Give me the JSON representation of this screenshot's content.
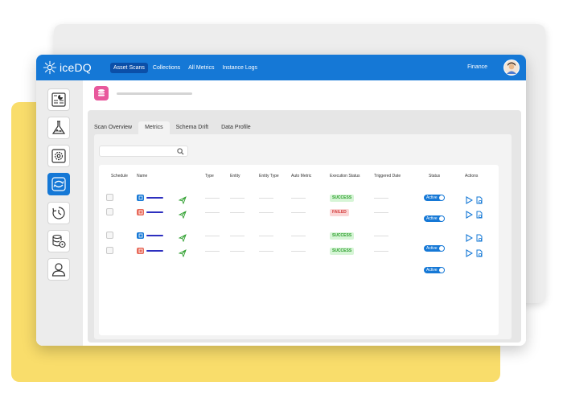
{
  "app": {
    "logo_text": "iceDQ"
  },
  "nav": {
    "items": [
      "Asset Scans",
      "Collections",
      "All Metrics",
      "Instance Logs"
    ],
    "active_index": 0
  },
  "header": {
    "org": "Finance"
  },
  "sidebar": {
    "items": [
      "dashboard-icon",
      "flask-icon",
      "settings-gear-icon",
      "scan-icon",
      "schedule-icon",
      "database-settings-icon",
      "user-icon"
    ],
    "active_index": 3
  },
  "tabs": {
    "items": [
      "Scan Overview",
      "Metrics",
      "Schema Drift",
      "Data Profile"
    ],
    "active_index": 1
  },
  "table": {
    "columns": [
      "Schedule",
      "Name",
      "Type",
      "Entity",
      "Entity Type",
      "Auto Metric",
      "Execution Status",
      "Triggered Date",
      "Status",
      "Actions"
    ],
    "rows": [
      {
        "icon": "blue",
        "execution_status": "SUCCESS",
        "status": "Active"
      },
      {
        "icon": "red",
        "execution_status": "FAILED",
        "status": "Active"
      },
      {
        "icon": "blue",
        "execution_status": "SUCCESS",
        "status": "Active"
      },
      {
        "icon": "red",
        "execution_status": "SUCCESS",
        "status": "Active"
      }
    ]
  },
  "colors": {
    "primary": "#1578d6",
    "success": "#2a9d2a",
    "failed": "#d23a3a",
    "accent_pink": "#e8589c",
    "yellow": "#f9dd6b"
  }
}
